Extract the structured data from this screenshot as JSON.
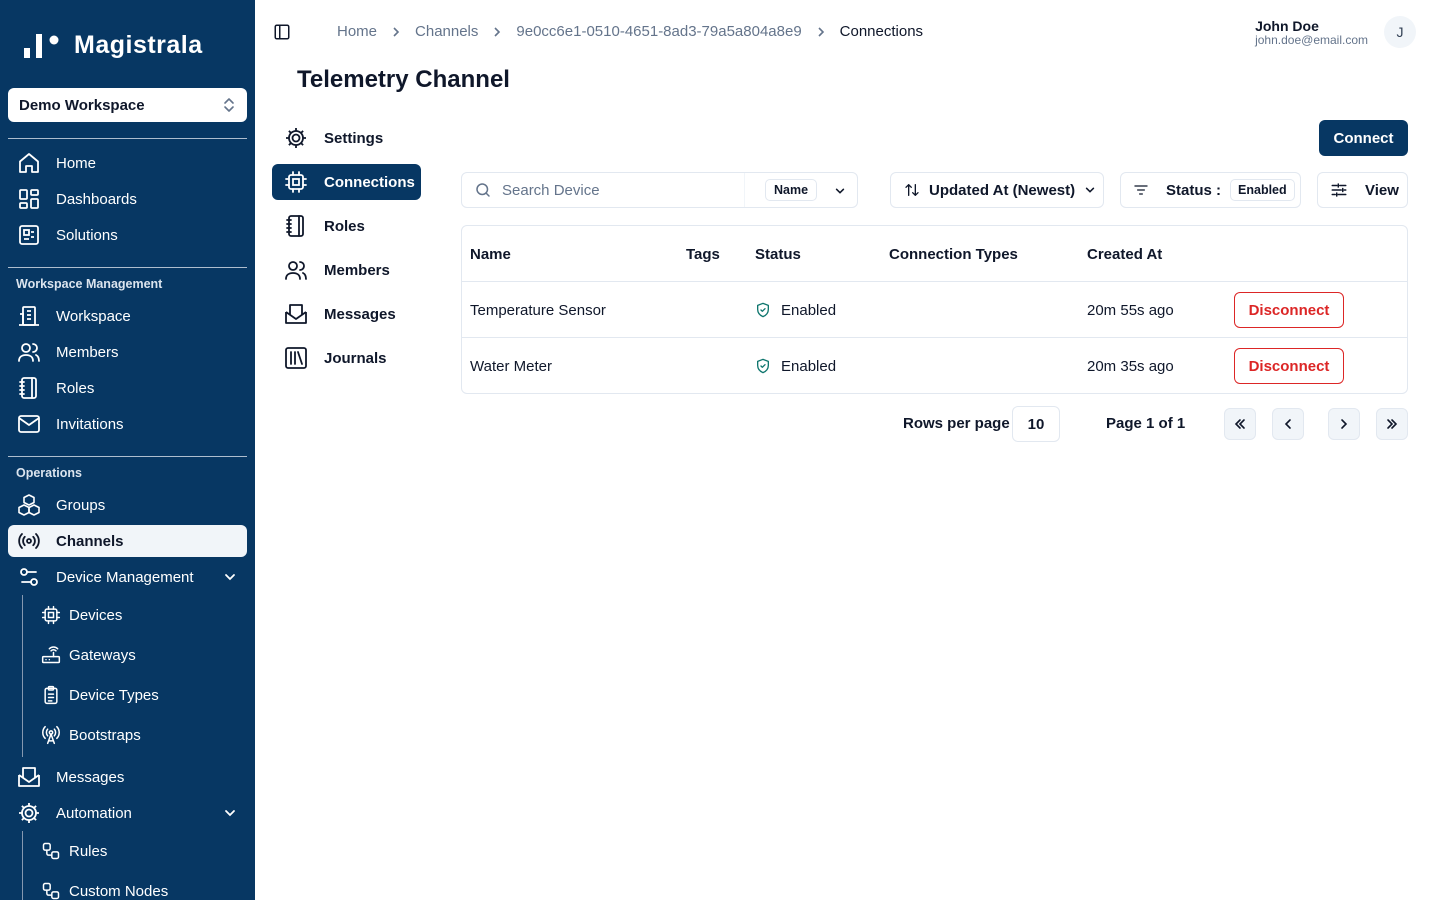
{
  "app": {
    "name": "Magistrala"
  },
  "workspace_selector": {
    "value": "Demo Workspace"
  },
  "sidebar": {
    "top_items": [
      {
        "label": "Home",
        "icon": "home-icon"
      },
      {
        "label": "Dashboards",
        "icon": "dashboard-icon"
      },
      {
        "label": "Solutions",
        "icon": "solutions-icon"
      }
    ],
    "workspace_group": {
      "label": "Workspace Management",
      "items": [
        {
          "label": "Workspace",
          "icon": "building-icon"
        },
        {
          "label": "Members",
          "icon": "users-icon"
        },
        {
          "label": "Roles",
          "icon": "notebook-icon"
        },
        {
          "label": "Invitations",
          "icon": "mail-icon"
        }
      ]
    },
    "operations_group": {
      "label": "Operations",
      "items": [
        {
          "label": "Groups",
          "icon": "boxes-icon"
        },
        {
          "label": "Channels",
          "icon": "radio-icon",
          "active": true
        },
        {
          "label": "Device Management",
          "icon": "sliders-icon"
        }
      ]
    },
    "device_management_items": [
      {
        "label": "Devices",
        "icon": "cpu-icon"
      },
      {
        "label": "Gateways",
        "icon": "router-icon"
      },
      {
        "label": "Device Types",
        "icon": "clipboard-icon"
      },
      {
        "label": "Bootstraps",
        "icon": "antenna-icon"
      }
    ],
    "bottom_items": [
      {
        "label": "Messages",
        "icon": "mail-open-icon"
      },
      {
        "label": "Automation",
        "icon": "gear-icon"
      }
    ],
    "automation_items": [
      {
        "label": "Rules",
        "icon": "workflow-icon"
      },
      {
        "label": "Custom Nodes",
        "icon": "workflow-icon"
      }
    ]
  },
  "header": {
    "breadcrumb": [
      "Home",
      "Channels",
      "9e0cc6e1-0510-4651-8ad3-79a5a804a8e9",
      "Connections"
    ],
    "user": {
      "name": "John Doe",
      "email": "john.doe@email.com",
      "avatar_initial": "J"
    }
  },
  "page": {
    "title": "Telemetry Channel"
  },
  "subnav": [
    {
      "label": "Settings",
      "icon": "gear-icon"
    },
    {
      "label": "Connections",
      "icon": "cpu-icon",
      "active": true
    },
    {
      "label": "Roles",
      "icon": "notebook-icon"
    },
    {
      "label": "Members",
      "icon": "users-icon"
    },
    {
      "label": "Messages",
      "icon": "mail-open-icon"
    },
    {
      "label": "Journals",
      "icon": "library-icon"
    }
  ],
  "toolbar": {
    "connect_label": "Connect",
    "search_placeholder": "Search Device",
    "search_value": "",
    "search_field": "Name",
    "sort_label": "Updated At (Newest)",
    "status_label": "Status :",
    "status_value": "Enabled",
    "view_label": "View"
  },
  "table": {
    "columns": [
      "Name",
      "Tags",
      "Status",
      "Connection Types",
      "Created At"
    ],
    "rows": [
      {
        "name": "Temperature Sensor",
        "tags": "",
        "status": "Enabled",
        "connection_types": "",
        "created_at": "20m 55s ago",
        "action": "Disconnect"
      },
      {
        "name": "Water Meter",
        "tags": "",
        "status": "Enabled",
        "connection_types": "",
        "created_at": "20m 35s ago",
        "action": "Disconnect"
      }
    ]
  },
  "pagination": {
    "rows_per_page_label": "Rows per page",
    "rows_per_page": "10",
    "page_label": "Page 1 of 1"
  },
  "colors": {
    "sidebar_bg": "#073763",
    "primary": "#073763",
    "danger": "#dc2626",
    "enabled": "#0f766e"
  }
}
